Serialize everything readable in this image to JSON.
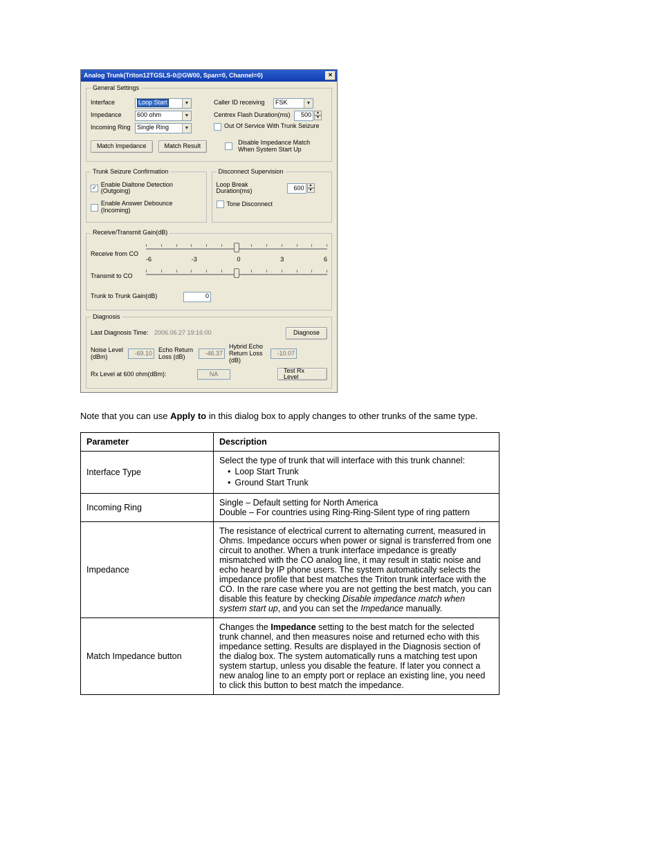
{
  "dialog": {
    "title": "Analog Trunk(Triton12TGSLS-0@GW00, Span=0, Channel=0)",
    "general": {
      "legend": "General Settings",
      "interface_lbl": "Interface",
      "interface_val": "Loop Start",
      "impedance_lbl": "Impedance",
      "impedance_val": "600 ohm",
      "incoming_lbl": "Incoming Ring",
      "incoming_val": "Single Ring",
      "callerid_lbl": "Caller ID receiving",
      "callerid_val": "FSK",
      "centrex_lbl": "Centrex Flash Duration(ms)",
      "centrex_val": "500",
      "oos_lbl": "Out Of Service With Trunk Seizure",
      "match_imp_btn": "Match Impedance",
      "match_res_btn": "Match Result",
      "disable_match_lbl": "Disable Impedance Match When System Start Up"
    },
    "seizure": {
      "legend": "Trunk Seizure Confirmation",
      "dialtone_lbl": "Enable Dialtone Detection (Outgoing)",
      "debounce_lbl": "Enable Answer Debounce (Incoming)"
    },
    "disconnect": {
      "legend": "Disconnect Supervision",
      "loopbreak_lbl": "Loop Break Duration(ms)",
      "loopbreak_val": "600",
      "tone_lbl": "Tone Disconnect"
    },
    "gain": {
      "legend": "Receive/Transmit Gain(dB)",
      "recv_lbl": "Receive from CO",
      "xmit_lbl": "Transmit to CO",
      "ticks": [
        "-6",
        "",
        "-3",
        "",
        "0",
        "",
        "3",
        "",
        "6"
      ],
      "ttg_lbl": "Trunk to Trunk Gain(dB)",
      "ttg_val": "0"
    },
    "diag": {
      "legend": "Diagnosis",
      "last_lbl": "Last Diagnosis Time:",
      "last_val": "2006.06.27 19:16:00",
      "diagnose_btn": "Diagnose",
      "noise_lbl": "Noise Level (dBm)",
      "noise_val": "-69.10",
      "erl_lbl": "Echo Return Loss (dB)",
      "erl_val": "-46.37",
      "herl_lbl": "Hybrid Echo Return Loss (dB)",
      "herl_val": "-10.07",
      "rx_lbl": "Rx Level at 600 ohm(dBm):",
      "rx_val": "NA",
      "testrx_btn": "Test Rx Level"
    }
  },
  "note": {
    "pre": "Note that you can use ",
    "bold": "Apply to",
    "post": " in this dialog box to apply changes to other trunks of the same type."
  },
  "table": {
    "h1": "Parameter",
    "h2": "Description",
    "rows": [
      {
        "param": "Interface Type",
        "desc_intro": "Select the type of trunk that will interface with this trunk channel:",
        "bullets": [
          "Loop Start Trunk",
          "Ground Start Trunk"
        ]
      },
      {
        "param": "Incoming Ring",
        "lines": [
          "Single – Default setting for North America",
          "Double – For countries using Ring-Ring-Silent type of ring pattern"
        ]
      },
      {
        "param": "Impedance",
        "text_a": "The resistance of electrical current to alternating current, measured in Ohms. Impedance occurs when power or signal is transferred from one circuit to another. When a trunk interface impedance is greatly mismatched with the CO analog line, it may result in static noise and echo heard by IP phone users. The system automatically selects the impedance profile that best matches the Triton trunk interface with the CO. In the rare case where you are not getting the best match, you can disable this feature by checking ",
        "ital_a": "Disable impedance match when system start up",
        "text_b": ", and you can set the ",
        "ital_b": "Impedance",
        "text_c": " manually."
      },
      {
        "param": "Match Impedance button",
        "text_a": "Changes the ",
        "bold_a": "Impedance",
        "text_b": " setting to the best match for the selected trunk channel, and then measures noise and returned echo with this impedance setting. Results are displayed in the Diagnosis section of the dialog box. The system automatically runs a matching test upon system startup, unless you disable the feature. If later you connect a new analog line to an empty port or replace an existing line, you need to click this button to best match the impedance."
      }
    ]
  }
}
